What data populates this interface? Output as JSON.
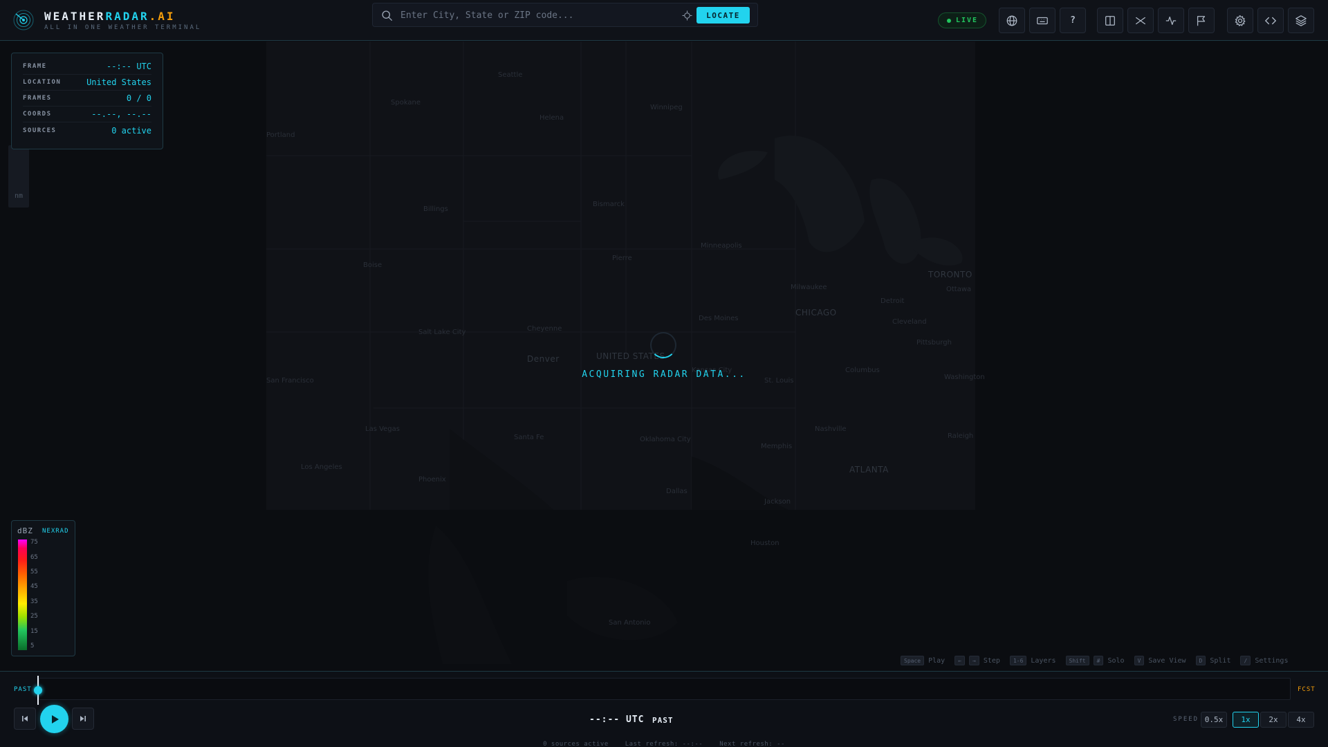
{
  "header": {
    "brand_part1": "WEATHER",
    "brand_part2": "RADAR",
    "brand_part3": ".AI",
    "tagline": "ALL IN ONE WEATHER TERMINAL",
    "search_placeholder": "Enter City, State or ZIP code...",
    "locate_label": "LOCATE",
    "live_label": "LIVE",
    "help_label": "?"
  },
  "info_panel": {
    "rows": [
      {
        "label": "FRAME",
        "value": "--:-- UTC"
      },
      {
        "label": "LOCATION",
        "value": "United States"
      },
      {
        "label": "FRAMES",
        "value": "0 / 0"
      },
      {
        "label": "COORDS",
        "value": "--.--, --.--"
      },
      {
        "label": "SOURCES",
        "value": "0 active"
      }
    ],
    "side_tag": "nm"
  },
  "map": {
    "loading_text": "ACQUIRING RADAR DATA...",
    "cities": [
      {
        "name": "Seattle"
      },
      {
        "name": "Spokane"
      },
      {
        "name": "Portland"
      },
      {
        "name": "Helena"
      },
      {
        "name": "Billings"
      },
      {
        "name": "Boise"
      },
      {
        "name": "Salt Lake City"
      },
      {
        "name": "Denver"
      },
      {
        "name": "Bismarck"
      },
      {
        "name": "Pierre"
      },
      {
        "name": "Minneapolis"
      },
      {
        "name": "Des Moines"
      },
      {
        "name": "Cheyenne"
      },
      {
        "name": "UNITED STATES"
      },
      {
        "name": "Milwaukee"
      },
      {
        "name": "CHICAGO"
      },
      {
        "name": "Detroit"
      },
      {
        "name": "TORONTO"
      },
      {
        "name": "Ottawa"
      },
      {
        "name": "Cleveland"
      },
      {
        "name": "Pittsburgh"
      },
      {
        "name": "Columbus"
      },
      {
        "name": "St. Louis"
      },
      {
        "name": "Kansas City"
      },
      {
        "name": "San Francisco"
      },
      {
        "name": "Las Vegas"
      },
      {
        "name": "Los Angeles"
      },
      {
        "name": "Phoenix"
      },
      {
        "name": "Santa Fe"
      },
      {
        "name": "Oklahoma City"
      },
      {
        "name": "Memphis"
      },
      {
        "name": "Nashville"
      },
      {
        "name": "ATLANTA"
      },
      {
        "name": "Dallas"
      },
      {
        "name": "Jackson"
      },
      {
        "name": "Raleigh"
      },
      {
        "name": "Winnipeg"
      },
      {
        "name": "Washington"
      },
      {
        "name": "Houston"
      },
      {
        "name": "San Antonio"
      }
    ]
  },
  "legend": {
    "title": "dBZ",
    "source": "NEXRAD",
    "ticks": [
      "75",
      "65",
      "55",
      "45",
      "35",
      "25",
      "15",
      "5"
    ]
  },
  "shortcuts": [
    {
      "keys": [
        "Space"
      ],
      "label": "Play"
    },
    {
      "keys": [
        "←",
        "→"
      ],
      "label": "Step"
    },
    {
      "keys": [
        "1-6"
      ],
      "label": "Layers"
    },
    {
      "keys": [
        "Shift",
        "#"
      ],
      "label": "Solo"
    },
    {
      "keys": [
        "V"
      ],
      "label": "Save View"
    },
    {
      "keys": [
        "D"
      ],
      "label": "Split"
    },
    {
      "keys": [
        "/"
      ],
      "label": "Settings"
    }
  ],
  "timeline": {
    "past_label": "PAST",
    "forecast_label": "FCST",
    "position": 0,
    "time": "--:-- UTC",
    "phase": "PAST",
    "speed_label": "SPEED",
    "speeds": [
      "0.5x",
      "1x",
      "2x",
      "4x"
    ],
    "active_speed": "1x"
  },
  "status": {
    "sources": "0 sources active",
    "last_refresh": "Last refresh: --:--",
    "next_refresh": "Next refresh: --"
  },
  "colors": {
    "accent": "#22d3ee",
    "forecast": "#f59e0b",
    "live": "#22c55e",
    "background": "#0b0d11"
  }
}
